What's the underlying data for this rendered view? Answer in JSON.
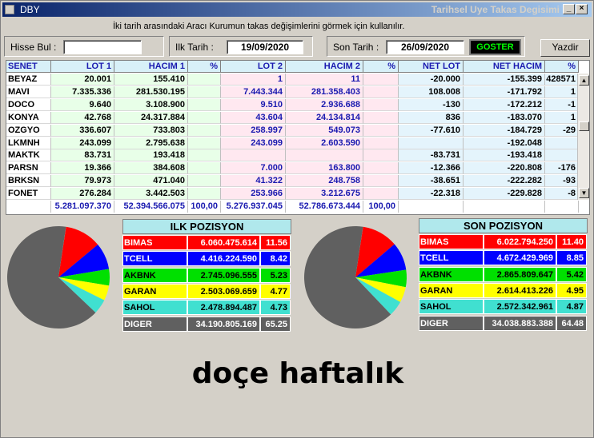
{
  "window": {
    "app_name": "DBY",
    "title": "Tarihsel Uye Takas Degisimi",
    "minimize": "_",
    "maximize": "□",
    "close": "×"
  },
  "toolbar": {
    "info_text": "İki tarih arasındaki  Aracı Kurumun takas değişimlerini görmek için kullanılır.",
    "search_label": "Hisse Bul :",
    "search_value": "",
    "start_label": "Ilk Tarih :",
    "start_date": "19/09/2020",
    "end_label": "Son Tarih :",
    "end_date": "26/09/2020",
    "show_label": "GOSTER",
    "print_label": "Yazdir"
  },
  "table": {
    "headers": [
      "SENET",
      "LOT 1",
      "HACIM 1",
      "%",
      "LOT 2",
      "HACIM 2",
      "%",
      "NET LOT",
      "NET HACIM",
      "%"
    ],
    "rows": [
      [
        "BEYAZ",
        "20.001",
        "155.410",
        "",
        "1",
        "11",
        "",
        "-20.000",
        "-155.399",
        "428571"
      ],
      [
        "MAVI",
        "7.335.336",
        "281.530.195",
        "",
        "7.443.344",
        "281.358.403",
        "",
        "108.008",
        "-171.792",
        "1"
      ],
      [
        "DOCO",
        "9.640",
        "3.108.900",
        "",
        "9.510",
        "2.936.688",
        "",
        "-130",
        "-172.212",
        "-1"
      ],
      [
        "KONYA",
        "42.768",
        "24.317.884",
        "",
        "43.604",
        "24.134.814",
        "",
        "836",
        "-183.070",
        "1"
      ],
      [
        "OZGYO",
        "336.607",
        "733.803",
        "",
        "258.997",
        "549.073",
        "",
        "-77.610",
        "-184.729",
        "-29"
      ],
      [
        "LKMNH",
        "243.099",
        "2.795.638",
        "",
        "243.099",
        "2.603.590",
        "",
        "",
        "-192.048",
        ""
      ],
      [
        "MAKTK",
        "83.731",
        "193.418",
        "",
        "",
        "",
        "",
        "-83.731",
        "-193.418",
        ""
      ],
      [
        "PARSN",
        "19.366",
        "384.608",
        "",
        "7.000",
        "163.800",
        "",
        "-12.366",
        "-220.808",
        "-176"
      ],
      [
        "BRKSN",
        "79.973",
        "471.040",
        "",
        "41.322",
        "248.758",
        "",
        "-38.651",
        "-222.282",
        "-93"
      ],
      [
        "FONET",
        "276.284",
        "3.442.503",
        "",
        "253.966",
        "3.212.675",
        "",
        "-22.318",
        "-229.828",
        "-8"
      ]
    ],
    "totals": [
      "",
      "5.281.097.370",
      "52.394.566.075",
      "100,00",
      "5.276.937.045",
      "52.786.673.444",
      "100,00",
      "",
      "",
      ""
    ]
  },
  "ilk": {
    "title": "ILK POZISYON",
    "rows": [
      {
        "name": "BIMAS",
        "value": "6.060.475.614",
        "pct": "11.56",
        "color": "#ff0000"
      },
      {
        "name": "TCELL",
        "value": "4.416.224.590",
        "pct": "8.42",
        "color": "#0000ff"
      },
      {
        "name": "AKBNK",
        "value": "2.745.096.555",
        "pct": "5.23",
        "color": "#00e000"
      },
      {
        "name": "GARAN",
        "value": "2.503.069.659",
        "pct": "4.77",
        "color": "#ffff00"
      },
      {
        "name": "SAHOL",
        "value": "2.478.894.487",
        "pct": "4.73",
        "color": "#40e0d0"
      },
      {
        "name": "DIGER",
        "value": "34.190.805.169",
        "pct": "65.25",
        "color": "#606060"
      }
    ]
  },
  "son": {
    "title": "SON POZISYON",
    "rows": [
      {
        "name": "BIMAS",
        "value": "6.022.794.250",
        "pct": "11.40",
        "color": "#ff0000"
      },
      {
        "name": "TCELL",
        "value": "4.672.429.969",
        "pct": "8.85",
        "color": "#0000ff"
      },
      {
        "name": "AKBNK",
        "value": "2.865.809.647",
        "pct": "5.42",
        "color": "#00e000"
      },
      {
        "name": "GARAN",
        "value": "2.614.413.226",
        "pct": "4.95",
        "color": "#ffff00"
      },
      {
        "name": "SAHOL",
        "value": "2.572.342.961",
        "pct": "4.87",
        "color": "#40e0d0"
      },
      {
        "name": "DIGER",
        "value": "34.038.883.388",
        "pct": "64.48",
        "color": "#606060"
      }
    ]
  },
  "caption": "doçe haftalık"
}
